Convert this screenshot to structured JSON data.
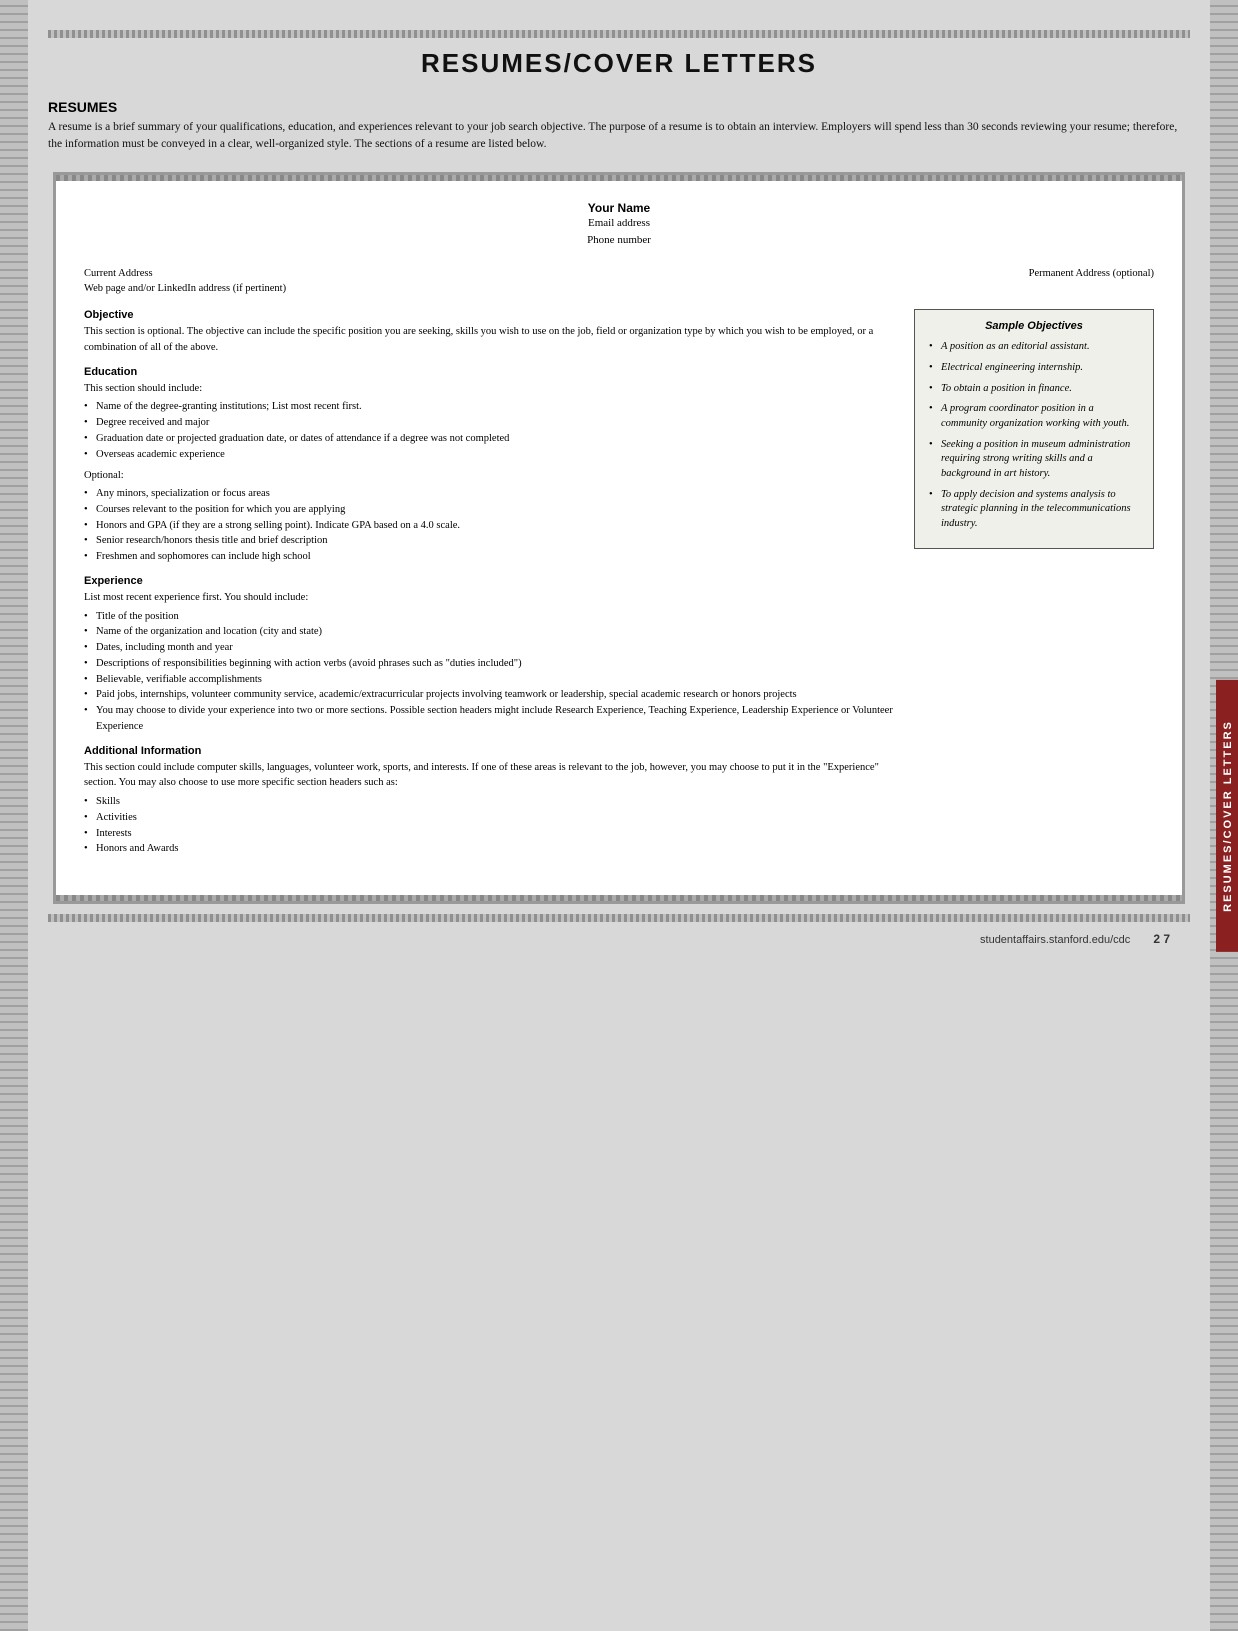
{
  "page": {
    "title": "RESUMES/COVER LETTERS",
    "right_tab": "RESUMES/COVER LETTERS",
    "footer_url": "studentaffairs.stanford.edu/cdc",
    "footer_page": "2 7"
  },
  "intro": {
    "heading": "RESUMES",
    "text": "A resume is a brief summary of your qualifications, education, and experiences relevant to your job search objective. The purpose of a resume is to obtain an interview. Employers will spend less than 30 seconds reviewing your resume; therefore, the information must be conveyed in a clear, well-organized style. The sections of a resume are listed below."
  },
  "resume_template": {
    "name": "Your Name",
    "email": "Email address",
    "phone": "Phone number",
    "current_address": "Current Address",
    "web_address": "Web page and/or LinkedIn address (if pertinent)",
    "permanent_address": "Permanent Address (optional)",
    "sections": {
      "objective": {
        "title": "Objective",
        "text": "This section is optional. The objective can include the specific position you are seeking, skills you wish to use on the job, field or organization type by which you wish to be employed, or a combination of all of the above."
      },
      "education": {
        "title": "Education",
        "intro": "This section should include:",
        "items": [
          "Name of the degree-granting institutions; List most recent first.",
          "Degree received and major",
          "Graduation date or projected graduation date, or dates of attendance if a degree was not completed",
          "Overseas academic experience"
        ],
        "optional_label": "Optional:",
        "optional_items": [
          "Any minors, specialization or focus areas",
          "Courses relevant to the position for which you are applying",
          "Honors and GPA (if they are a strong selling point). Indicate GPA based on a 4.0 scale.",
          "Senior research/honors thesis title and brief description",
          "Freshmen and sophomores can include high school"
        ]
      },
      "experience": {
        "title": "Experience",
        "intro": "List most recent experience first. You should include:",
        "items": [
          "Title of the position",
          "Name of the organization and location (city and state)",
          "Dates, including month and year",
          "Descriptions of responsibilities beginning with action verbs (avoid phrases such as \"duties included\")",
          "Believable, verifiable accomplishments",
          "Paid jobs, internships, volunteer community service, academic/extracurricular projects involving teamwork or leadership, special academic research or honors projects",
          "You may choose to divide your experience into two or more sections. Possible section headers might include Research Experience, Teaching Experience, Leadership Experience or Volunteer Experience"
        ]
      },
      "additional_info": {
        "title": "Additional Information",
        "text": "This section could include computer skills, languages, volunteer work, sports, and interests. If one of these areas is relevant to the job, however, you may choose to put it in the \"Experience\" section. You may also choose to use more specific section headers such as:",
        "items": [
          "Skills",
          "Activities",
          "Interests",
          "Honors and Awards"
        ]
      }
    }
  },
  "sample_objectives": {
    "title": "Sample Objectives",
    "items": [
      "A position as an editorial assistant.",
      "Electrical engineering internship.",
      "To obtain a position in finance.",
      "A program coordinator position in a community organization working with youth.",
      "Seeking a position in museum administration requiring strong writing skills and a background in art history.",
      "To apply decision and systems analysis to strategic planning in the telecommunications industry."
    ]
  }
}
